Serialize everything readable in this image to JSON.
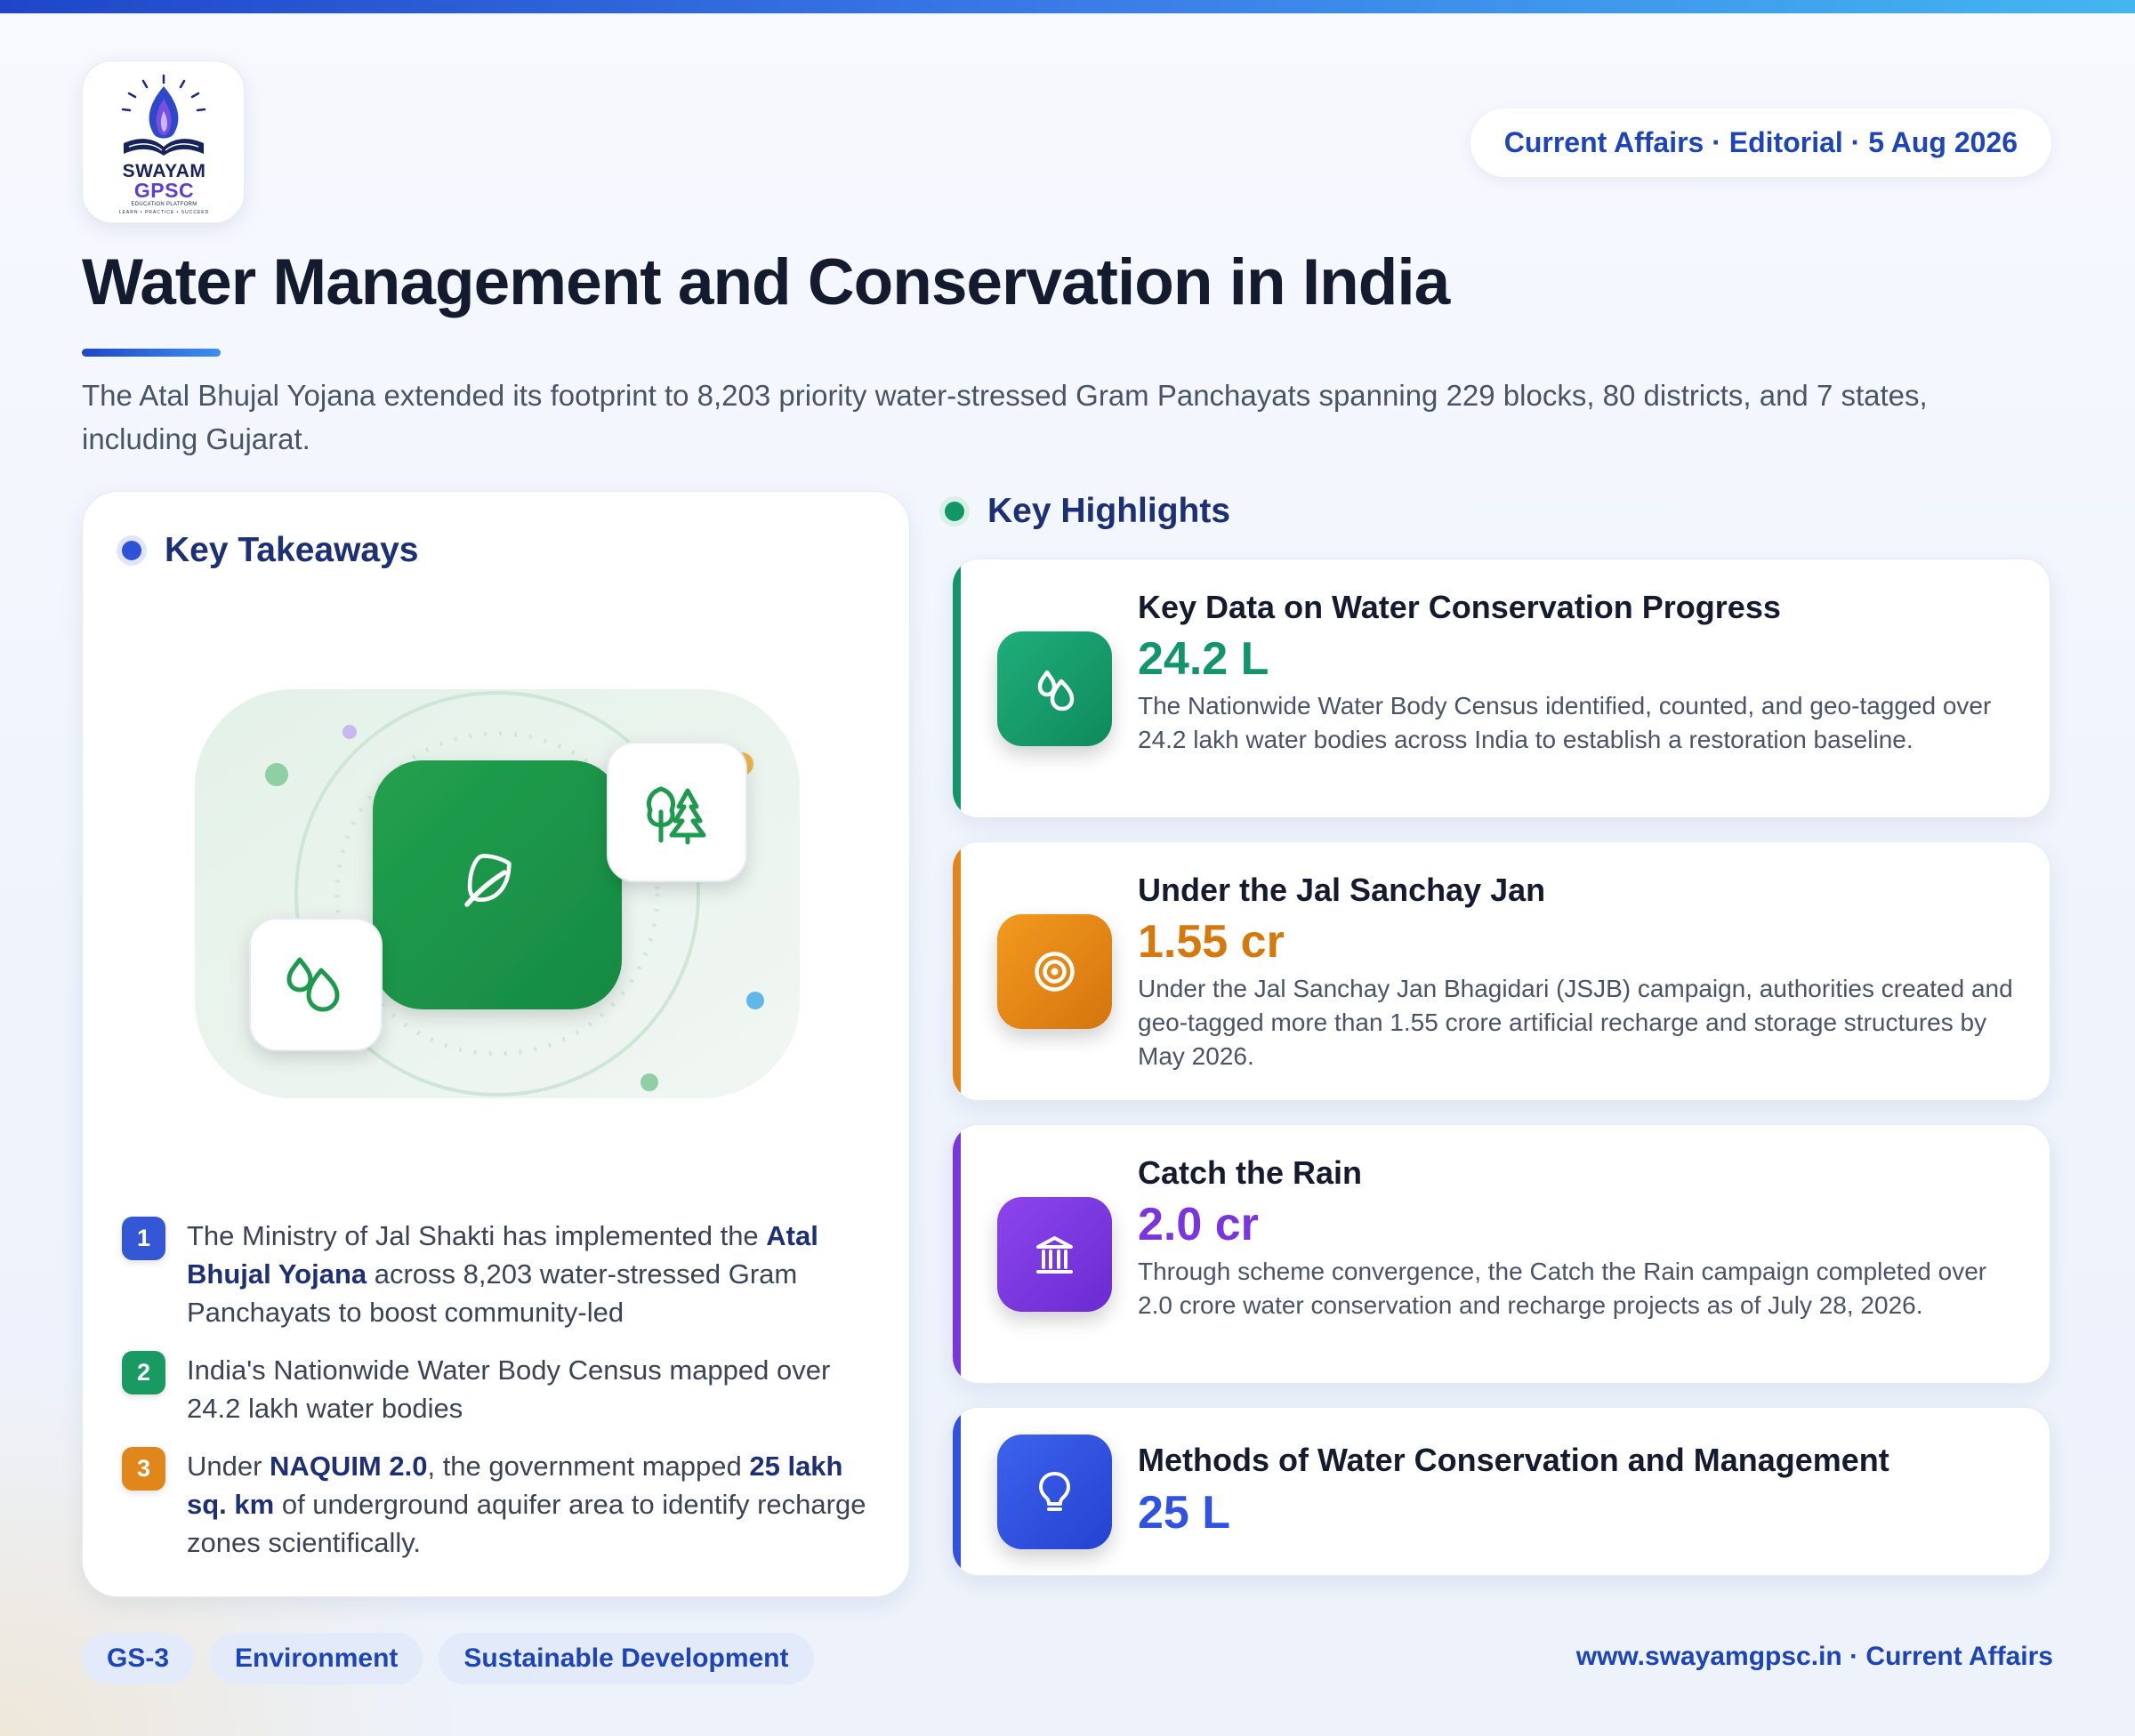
{
  "header": {
    "logo": {
      "line1": "SWAYAM",
      "line2": "GPSC",
      "line3": "EDUCATION PLATFORM",
      "line4": "LEARN • PRACTICE • SUCCEED"
    },
    "date_pill": "Current Affairs · Editorial · 5 Aug 2026",
    "title": "Water Management and Conservation in India",
    "subtitle": "The Atal Bhujal Yojana extended its footprint to 8,203 priority water-stressed Gram Panchayats spanning 229 blocks, 80 districts, and 7 states, including Gujarat."
  },
  "takeaways": {
    "heading": "Key Takeaways",
    "items": [
      {
        "num": "1",
        "color": "#3457d5",
        "parts": [
          {
            "t": "The Ministry of Jal Shakti has implemented the ",
            "b": false
          },
          {
            "t": "Atal Bhujal Yojana",
            "b": true
          },
          {
            "t": " across 8,203 water-stressed Gram Panchayats to boost community-led",
            "b": false
          }
        ]
      },
      {
        "num": "2",
        "color": "#1a9a63",
        "parts": [
          {
            "t": "India's Nationwide Water Body Census mapped over 24.2 lakh water bodies",
            "b": false
          }
        ]
      },
      {
        "num": "3",
        "color": "#e0861a",
        "parts": [
          {
            "t": "Under ",
            "b": false
          },
          {
            "t": "NAQUIM 2.0",
            "b": true
          },
          {
            "t": ", the government mapped ",
            "b": false
          },
          {
            "t": "25 lakh sq. km",
            "b": true
          },
          {
            "t": " of underground aquifer area to identify recharge zones scientifically.",
            "b": false
          }
        ]
      }
    ]
  },
  "highlights": {
    "heading": "Key Highlights",
    "cards": [
      {
        "title": "Key Data on Water Conservation Progress",
        "value": "24.2 L",
        "desc": "The Nationwide Water Body Census identified, counted, and geo-tagged over 24.2 lakh water bodies across India to establish a restoration baseline.",
        "color": "#13956a",
        "icon": "water-drops-icon"
      },
      {
        "title": "Under the Jal Sanchay Jan",
        "value": "1.55 cr",
        "desc": "Under the Jal Sanchay Jan Bhagidari (JSJB) campaign, authorities created and geo-tagged more than 1.55 crore artificial recharge and storage structures by May 2026.",
        "color": "#e0861a",
        "icon": "target-icon"
      },
      {
        "title": "Catch the Rain",
        "value": "2.0 cr",
        "desc": "Through scheme convergence, the Catch the Rain campaign completed over 2.0 crore water conservation and recharge projects as of July 28, 2026.",
        "color": "#7a35dc",
        "icon": "institution-icon"
      },
      {
        "title": "Methods of Water Conservation and Management",
        "value": "25 L",
        "desc": "",
        "color": "#3052e0",
        "icon": "lightbulb-icon"
      }
    ]
  },
  "tags": [
    "GS-3",
    "Environment",
    "Sustainable Development"
  ],
  "footer": "www.swayamgpsc.in · Current Affairs"
}
